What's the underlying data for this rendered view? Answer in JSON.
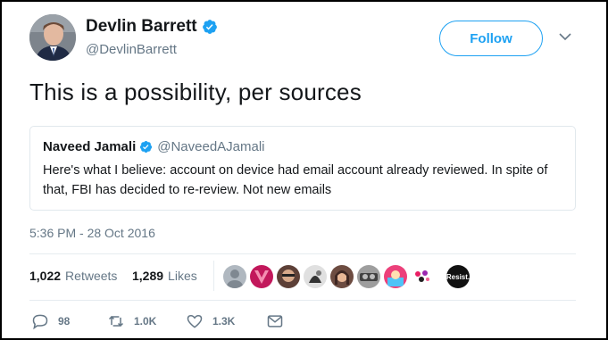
{
  "author": {
    "display_name": "Devlin Barrett",
    "handle": "@DevlinBarrett",
    "verified": true
  },
  "follow_button": {
    "label": "Follow"
  },
  "tweet": {
    "text": "This is a possibility, per sources"
  },
  "quoted_tweet": {
    "display_name": "Naveed Jamali",
    "handle": "@NaveedAJamali",
    "verified": true,
    "text": "Here's what I believe: account on device had email account already reviewed. In spite of that, FBI has decided to re-review. Not new emails"
  },
  "timestamp": "5:36 PM - 28 Oct 2016",
  "stats": {
    "retweets": {
      "count": "1,022",
      "label": "Retweets"
    },
    "likes": {
      "count": "1,289",
      "label": "Likes"
    }
  },
  "likers": {
    "last_label": "Resist."
  },
  "actions": {
    "replies": "98",
    "retweets": "1.0K",
    "likes": "1.3K"
  },
  "colors": {
    "accent": "#1da1f2",
    "secondary_text": "#657786",
    "primary_text": "#14171a",
    "border": "#e1e8ed"
  },
  "icons": [
    "verified-badge-icon",
    "chevron-down-icon",
    "reply-icon",
    "retweet-icon",
    "like-icon",
    "direct-message-icon"
  ]
}
